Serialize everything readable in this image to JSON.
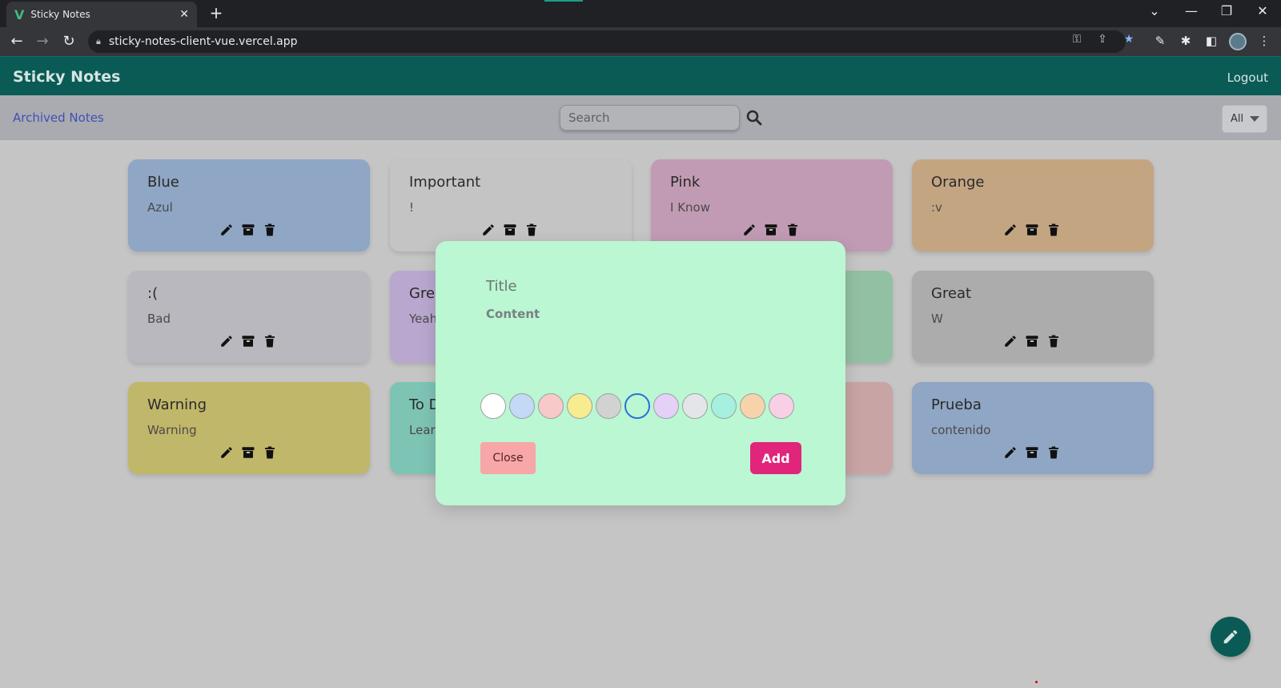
{
  "browser": {
    "tab_title": "Sticky Notes",
    "tab_logo": "V",
    "tab_close": "✕",
    "new_tab": "+",
    "url": "sticky-notes-client-vue.vercel.app",
    "window_controls": {
      "chevron": "⌄",
      "minimize": "—",
      "restore": "❐",
      "close": "✕"
    }
  },
  "header": {
    "title": "Sticky Notes",
    "logout_label": "Logout"
  },
  "subheader": {
    "archived_label": "Archived Notes",
    "search_placeholder": "Search",
    "filter_value": "All"
  },
  "notes": [
    {
      "title": "Blue",
      "content": "Azul",
      "color": "#8fa6c4"
    },
    {
      "title": "Important",
      "content": "!",
      "color": "#c4c4c4"
    },
    {
      "title": "Pink",
      "content": "I Know",
      "color": "#c19bb3"
    },
    {
      "title": "Orange",
      "content": ":v",
      "color": "#c4a582"
    },
    {
      "title": ":(",
      "content": "Bad",
      "color": "#b8b8be"
    },
    {
      "title": "Grea",
      "content": "Yeah",
      "color": "#b9a7cf"
    },
    {
      "title": "",
      "content": "",
      "color": "#92c0a2"
    },
    {
      "title": "Great",
      "content": "W",
      "color": "#acacac"
    },
    {
      "title": "Warning",
      "content": "Warning",
      "color": "#c0b76a"
    },
    {
      "title": "To D",
      "content": "Learr",
      "color": "#7ec4b5"
    },
    {
      "title": "",
      "content": "",
      "color": "#c9a4a4"
    },
    {
      "title": "Prueba",
      "content": "contenido",
      "color": "#8fa6c4"
    }
  ],
  "modal": {
    "title_placeholder": "Title",
    "content_placeholder": "Content",
    "swatches": [
      "#ffffff",
      "#c4d9f6",
      "#f8c9c9",
      "#f7ec8f",
      "#d2d2d2",
      "#baf7d2",
      "#e5d0f8",
      "#e4e5e9",
      "#a5f0de",
      "#f7d3ab",
      "#f9cfe6"
    ],
    "selected_swatch": "#baf7d2",
    "close_label": "Close",
    "add_label": "Add"
  },
  "colors": {
    "header": "#0a5b55",
    "accent": "#e0257a",
    "link": "#3f51b5"
  }
}
